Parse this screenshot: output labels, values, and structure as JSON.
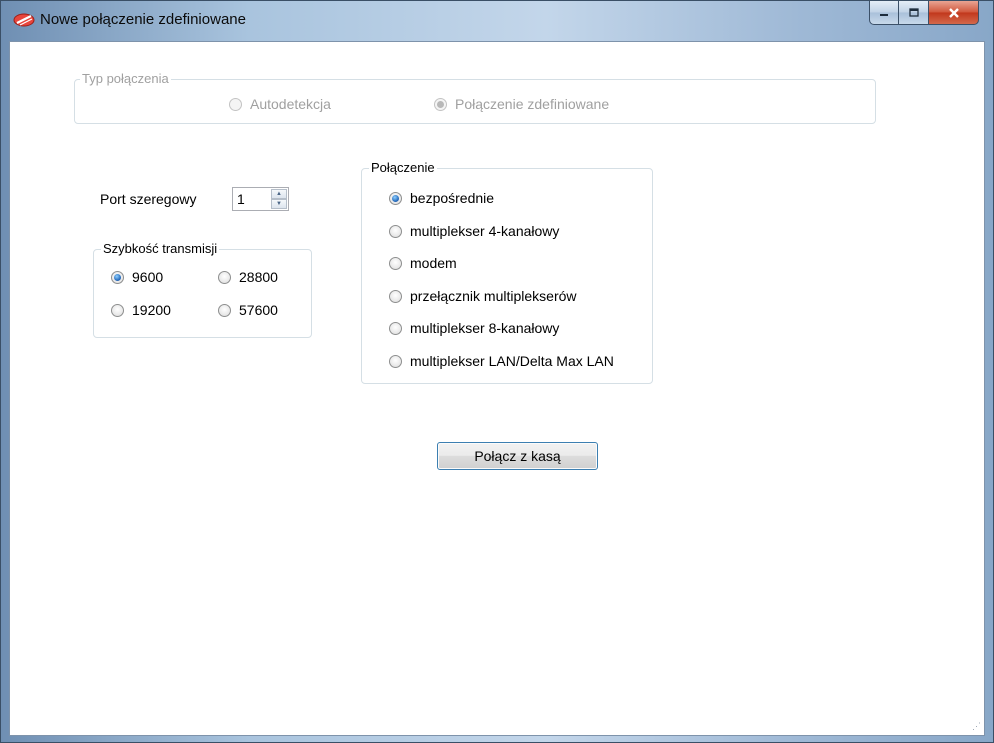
{
  "window": {
    "title": "Nowe połączenie zdefiniowane",
    "minimize_label": "–",
    "maximize_label": "☐",
    "close_label": "X"
  },
  "connection_type": {
    "legend": "Typ połączenia",
    "options": [
      {
        "label": "Autodetekcja",
        "checked": false,
        "enabled": false
      },
      {
        "label": "Połączenie zdefiniowane",
        "checked": true,
        "enabled": false
      }
    ]
  },
  "serial_port": {
    "label": "Port szeregowy",
    "value": "1"
  },
  "baud_rate": {
    "legend": "Szybkość transmisji",
    "options": [
      {
        "label": "9600",
        "checked": true
      },
      {
        "label": "28800",
        "checked": false
      },
      {
        "label": "19200",
        "checked": false
      },
      {
        "label": "57600",
        "checked": false
      }
    ]
  },
  "connection": {
    "legend": "Połączenie",
    "options": [
      {
        "label": "bezpośrednie",
        "checked": true
      },
      {
        "label": "multiplekser 4-kanałowy",
        "checked": false
      },
      {
        "label": "modem",
        "checked": false
      },
      {
        "label": "przełącznik multiplekserów",
        "checked": false
      },
      {
        "label": "multiplekser 8-kanałowy",
        "checked": false
      },
      {
        "label": "multiplekser LAN/Delta Max LAN",
        "checked": false
      }
    ]
  },
  "connect_button": "Połącz z kasą",
  "colors": {
    "button_border": "#3c7fb1",
    "radio_checked": "#2a6fbf",
    "disabled_text": "#a0a0a0"
  }
}
